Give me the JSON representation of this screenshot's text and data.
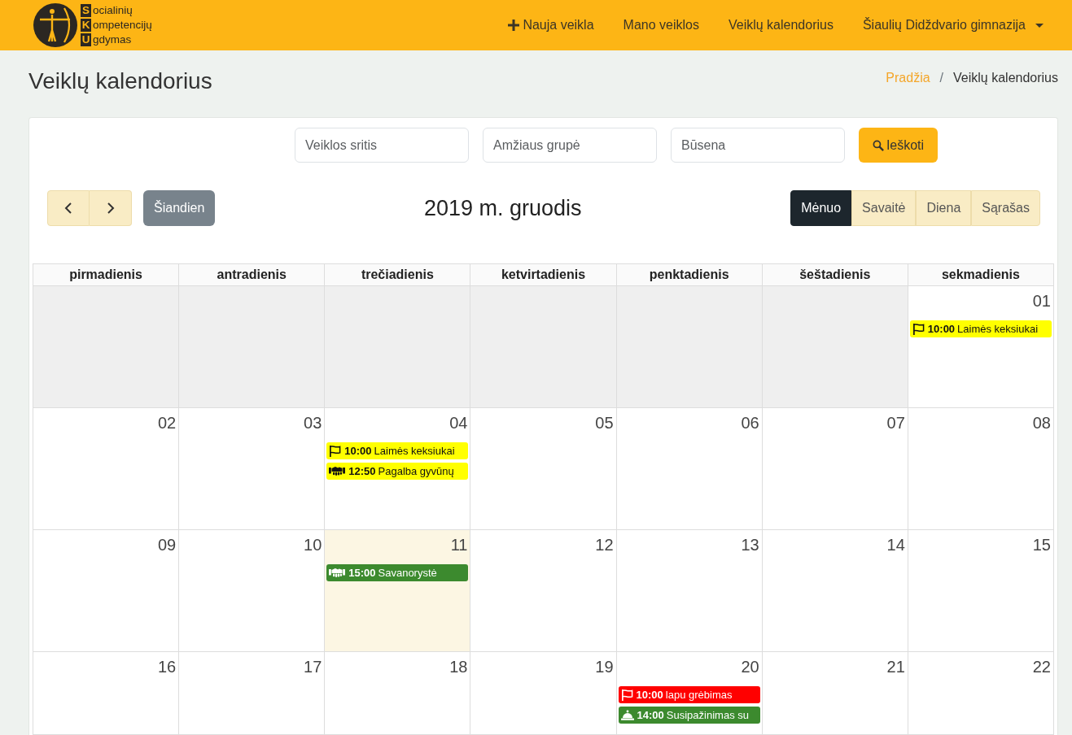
{
  "navbar": {
    "logo": {
      "lines": [
        {
          "initial": "S",
          "rest": "ocialinių"
        },
        {
          "initial": "K",
          "rest": "ompetencijų"
        },
        {
          "initial": "U",
          "rest": "gdymas"
        }
      ]
    },
    "items": [
      {
        "label": "Nauja veikla",
        "kind": "add",
        "dropdown": false
      },
      {
        "label": "Mano veiklos",
        "kind": "link",
        "dropdown": false
      },
      {
        "label": "Veiklų kalendorius",
        "kind": "link",
        "dropdown": false
      },
      {
        "label": "Šiaulių Didždvario gimnazija",
        "kind": "link",
        "dropdown": true
      }
    ]
  },
  "page_title": "Veiklų kalendorius",
  "breadcrumb": {
    "separator": "/",
    "items": [
      {
        "label": "Pradžia",
        "current": false
      },
      {
        "label": "Veiklų kalendorius",
        "current": true
      }
    ]
  },
  "filters": {
    "fields": [
      {
        "placeholder": "Veiklos sritis"
      },
      {
        "placeholder": "Amžiaus grupė"
      },
      {
        "placeholder": "Būsena"
      }
    ],
    "search_button": "Ieškoti"
  },
  "calendar": {
    "today_button": "Šiandien",
    "title": "2019 m. gruodis",
    "views": [
      {
        "label": "Mėnuo",
        "selected": true
      },
      {
        "label": "Savaitė",
        "selected": false
      },
      {
        "label": "Diena",
        "selected": false
      },
      {
        "label": "Sąrašas",
        "selected": false
      }
    ],
    "weekdays": [
      "pirmadienis",
      "antradienis",
      "trečiadienis",
      "ketvirtadienis",
      "penktadienis",
      "šeštadienis",
      "sekmadienis"
    ],
    "weeks": [
      [
        {
          "other_month": true,
          "today": false
        },
        {
          "other_month": true,
          "today": false
        },
        {
          "other_month": true,
          "today": false
        },
        {
          "other_month": true,
          "today": false
        },
        {
          "other_month": true,
          "today": false
        },
        {
          "other_month": true,
          "today": false
        },
        {
          "day": "01",
          "other_month": false,
          "today": false,
          "events": [
            {
              "kind": "flag",
              "time": "10:00",
              "title": "Laimės keksiukai",
              "color": "#ffff00"
            }
          ]
        }
      ],
      [
        {
          "day": "02",
          "other_month": false,
          "today": false
        },
        {
          "day": "03",
          "other_month": false,
          "today": false
        },
        {
          "day": "04",
          "other_month": false,
          "today": false,
          "events": [
            {
              "kind": "flag",
              "time": "10:00",
              "title": "Laimės keksiukai",
              "color": "#ffff00"
            },
            {
              "kind": "handshake",
              "time": "12:50",
              "title": "Pagalba gyvūnų",
              "color": "#ffff00"
            }
          ]
        },
        {
          "day": "05",
          "other_month": false,
          "today": false
        },
        {
          "day": "06",
          "other_month": false,
          "today": false
        },
        {
          "day": "07",
          "other_month": false,
          "today": false
        },
        {
          "day": "08",
          "other_month": false,
          "today": false
        }
      ],
      [
        {
          "day": "09",
          "other_month": false,
          "today": false
        },
        {
          "day": "10",
          "other_month": false,
          "today": false
        },
        {
          "day": "11",
          "other_month": false,
          "today": true,
          "events": [
            {
              "kind": "handshake",
              "time": "15:00",
              "title": "Savanorystė",
              "color": "#3c8a2e"
            }
          ]
        },
        {
          "day": "12",
          "other_month": false,
          "today": false
        },
        {
          "day": "13",
          "other_month": false,
          "today": false
        },
        {
          "day": "14",
          "other_month": false,
          "today": false
        },
        {
          "day": "15",
          "other_month": false,
          "today": false
        }
      ],
      [
        {
          "day": "16",
          "other_month": false,
          "today": false
        },
        {
          "day": "17",
          "other_month": false,
          "today": false
        },
        {
          "day": "18",
          "other_month": false,
          "today": false
        },
        {
          "day": "19",
          "other_month": false,
          "today": false
        },
        {
          "day": "20",
          "other_month": false,
          "today": false,
          "events": [
            {
              "kind": "flag",
              "time": "10:00",
              "title": "lapu grėbimas",
              "color": "#ff0000"
            },
            {
              "kind": "bell",
              "time": "14:00",
              "title": "Susipažinimas su",
              "color": "#3c8a2e"
            }
          ]
        },
        {
          "day": "21",
          "other_month": false,
          "today": false
        },
        {
          "day": "22",
          "other_month": false,
          "today": false
        }
      ]
    ]
  }
}
